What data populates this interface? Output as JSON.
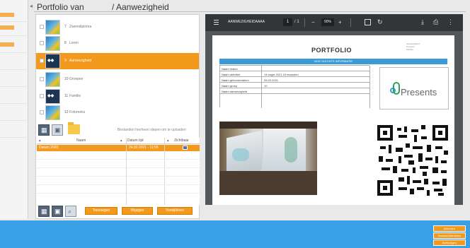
{
  "breadcrumb": {
    "root": "Portfolio van",
    "current": "/ Aanwezigheid"
  },
  "modules": [
    {
      "num": "7",
      "label": "Zwemdiploma",
      "thumb": "photo",
      "selected": false
    },
    {
      "num": "8",
      "label": "Leren",
      "thumb": "photo",
      "selected": false
    },
    {
      "num": "9",
      "label": "Aanwezigheid",
      "thumb": "logo",
      "selected": true
    },
    {
      "num": "10",
      "label": "Groepen",
      "thumb": "photo",
      "selected": false
    },
    {
      "num": "11",
      "label": "Familie",
      "thumb": "logo",
      "selected": false
    },
    {
      "num": "12",
      "label": "Fotoreeks",
      "thumb": "photo",
      "selected": false
    }
  ],
  "upload_hint": "Bestanden hierheen slepen om te uploaden",
  "table": {
    "headers": [
      "Naam",
      "Datum tijd",
      "Zichtbaar"
    ],
    "rows": [
      {
        "name": "Datum 2020",
        "datetime": "24.02.2021 - 11:55",
        "visible": true
      }
    ]
  },
  "actions": {
    "new": "Toevoegen",
    "edit": "Wijzigen",
    "delete": "Verwijderen"
  },
  "viewer": {
    "filename": "AANWEZIGHEIDAAAA",
    "page_current": "1",
    "page_total": "/ 1",
    "zoom": "90%"
  },
  "document": {
    "title": "PORTFOLIO",
    "info_lines": [
      "Aanwezigheid",
      "Groepen",
      "Familie"
    ],
    "section_bar": "NOG SLECHTS INFORMATIE",
    "fields": [
      {
        "key": "Naam maker",
        "value": ""
      },
      {
        "key": "Naam aktiviteit",
        "value": "14 augst 2021 16 maanden"
      },
      {
        "key": "Naam geboortedatum",
        "value": "09.02.2021"
      },
      {
        "key": "Naam groep",
        "value": "10"
      },
      {
        "key": "Naam aanwezigheid",
        "value": ""
      }
    ],
    "logo_text": "Presents"
  },
  "colors": {
    "accent": "#f39a1c",
    "footer": "#3aa0e6",
    "viewer_toolbar": "#323639",
    "doc_bar": "#3a9bd8"
  },
  "footer_buttons": [
    "Afronden",
    "Bewaar/afdrukken",
    "Beëindigen"
  ]
}
